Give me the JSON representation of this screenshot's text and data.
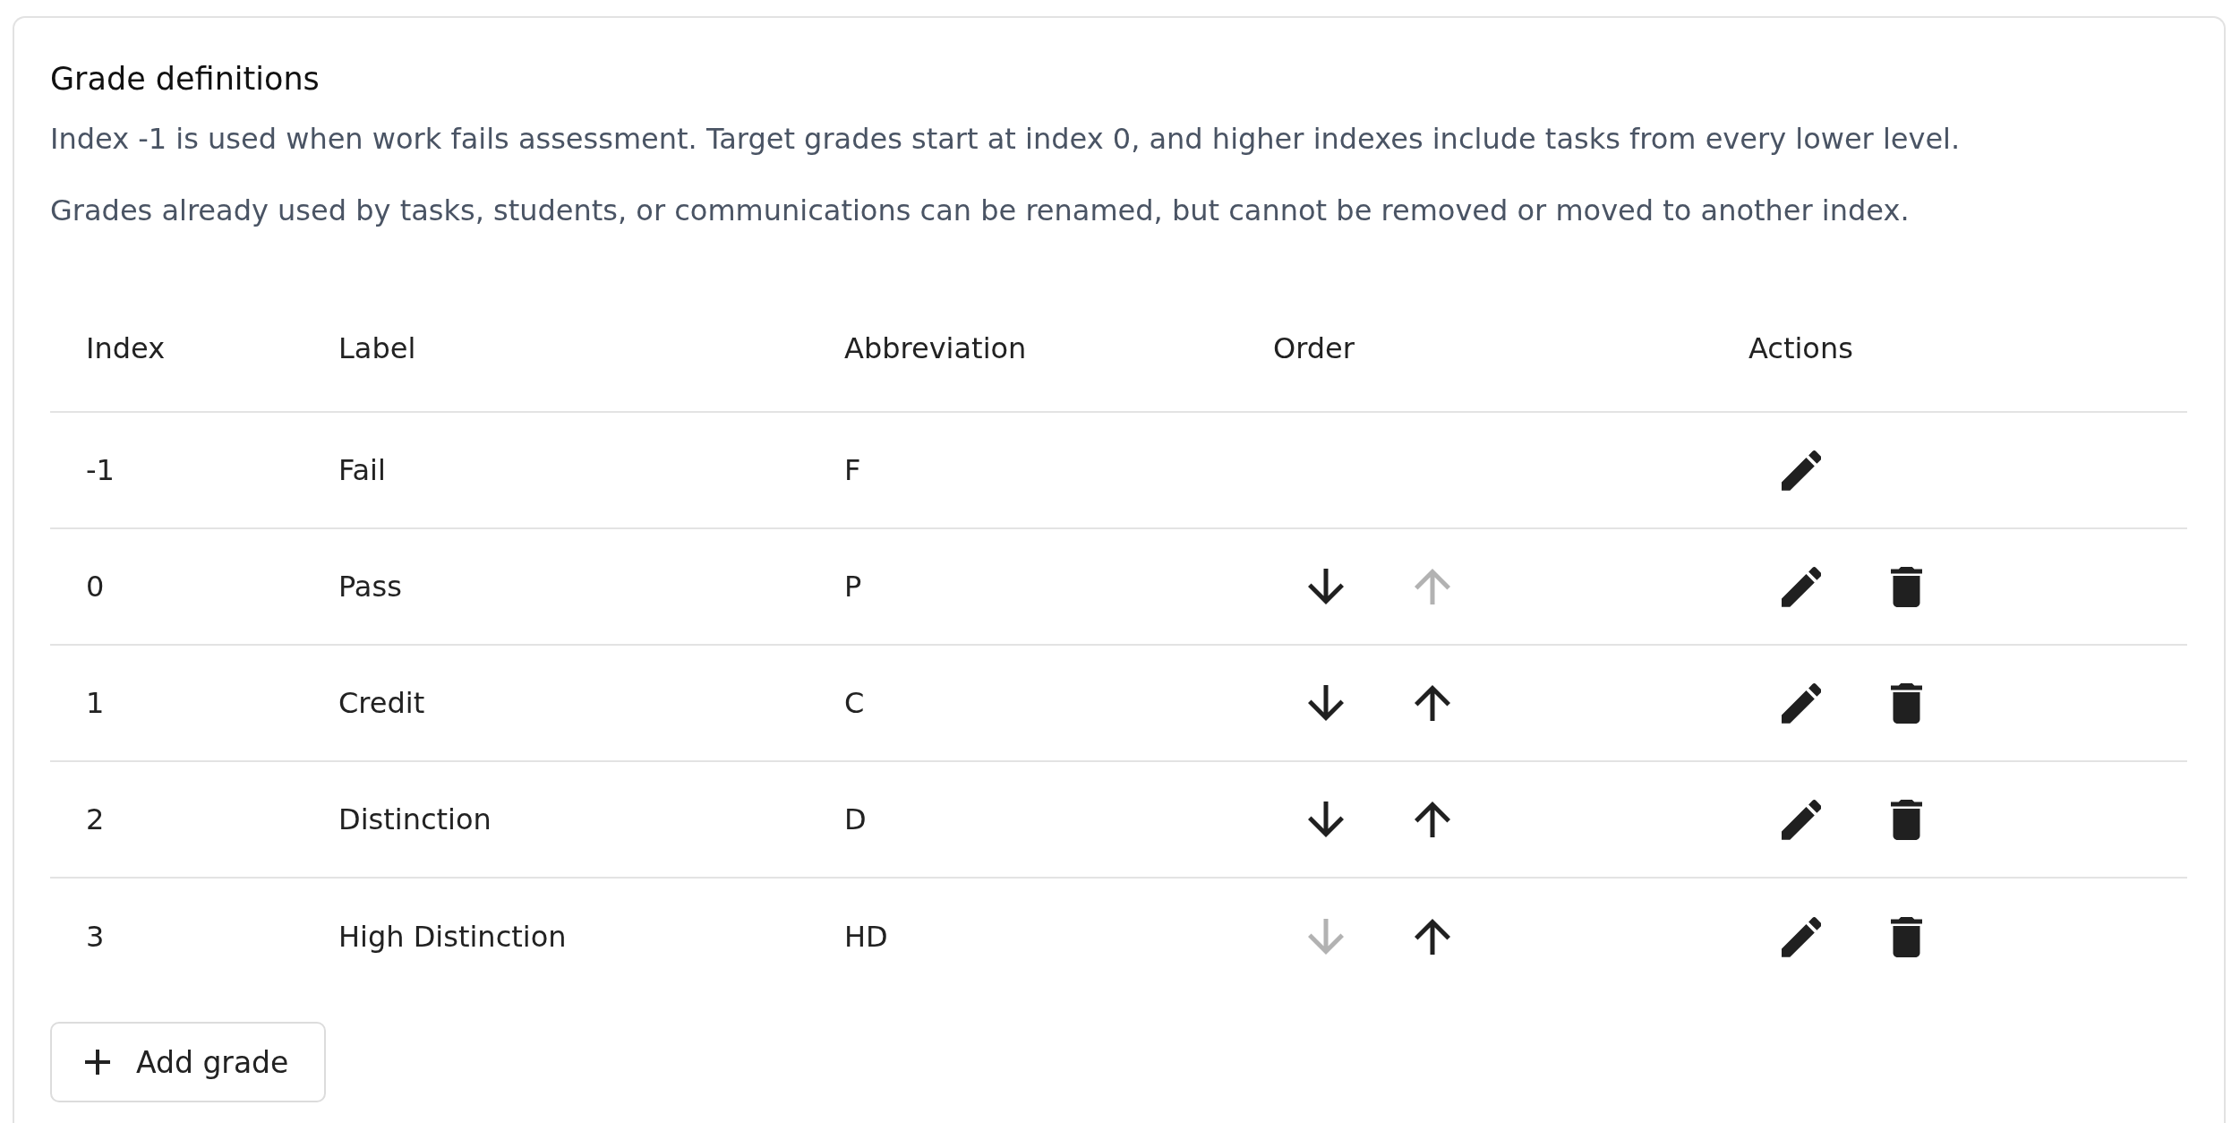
{
  "section": {
    "title": "Grade definitions",
    "descriptions": [
      "Index -1 is used when work fails assessment. Target grades start at index 0, and higher indexes include tasks from every lower level.",
      "Grades already used by tasks, students, or communications can be renamed, but cannot be removed or moved to another index."
    ]
  },
  "table": {
    "columns": [
      "Index",
      "Label",
      "Abbreviation",
      "Order",
      "Actions"
    ],
    "rows": [
      {
        "index": "-1",
        "label": "Fail",
        "abbreviation": "F",
        "actions": [
          {
            "kind": "edit"
          }
        ]
      },
      {
        "index": "0",
        "label": "Pass",
        "abbreviation": "P",
        "order_buttons": [
          {
            "kind": "down",
            "disabled": false
          },
          {
            "kind": "up",
            "disabled": true
          }
        ],
        "actions": [
          {
            "kind": "edit"
          },
          {
            "kind": "delete"
          }
        ]
      },
      {
        "index": "1",
        "label": "Credit",
        "abbreviation": "C",
        "order_buttons": [
          {
            "kind": "down",
            "disabled": false
          },
          {
            "kind": "up",
            "disabled": false
          }
        ],
        "actions": [
          {
            "kind": "edit"
          },
          {
            "kind": "delete"
          }
        ]
      },
      {
        "index": "2",
        "label": "Distinction",
        "abbreviation": "D",
        "order_buttons": [
          {
            "kind": "down",
            "disabled": false
          },
          {
            "kind": "up",
            "disabled": false
          }
        ],
        "actions": [
          {
            "kind": "edit"
          },
          {
            "kind": "delete"
          }
        ]
      },
      {
        "index": "3",
        "label": "High Distinction",
        "abbreviation": "HD",
        "order_buttons": [
          {
            "kind": "down",
            "disabled": true
          },
          {
            "kind": "up",
            "disabled": false
          }
        ],
        "actions": [
          {
            "kind": "edit"
          },
          {
            "kind": "delete"
          }
        ]
      }
    ]
  },
  "add_button": {
    "label": "Add grade"
  }
}
